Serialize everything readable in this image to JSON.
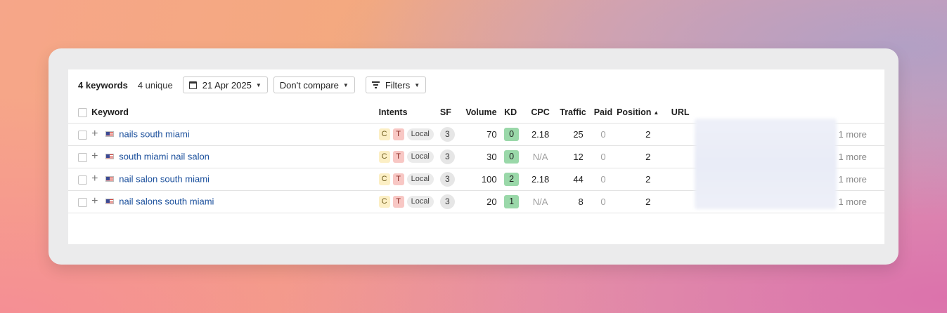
{
  "toolbar": {
    "keyword_count": "4 keywords",
    "unique": "4 unique",
    "date": "21 Apr 2025",
    "compare": "Don't compare",
    "filters": "Filters"
  },
  "columns": {
    "keyword": "Keyword",
    "intents": "Intents",
    "sf": "SF",
    "volume": "Volume",
    "kd": "KD",
    "cpc": "CPC",
    "traffic": "Traffic",
    "paid": "Paid",
    "position": "Position",
    "url": "URL"
  },
  "rows": [
    {
      "keyword": "nails south miami",
      "intent_c": "C",
      "intent_t": "T",
      "local": "Local",
      "sf": "3",
      "volume": "70",
      "kd": "0",
      "kd_color": "#9ad8a9",
      "cpc": "2.18",
      "traffic": "25",
      "paid": "0",
      "position": "2",
      "more": "1 more"
    },
    {
      "keyword": "south miami nail salon",
      "intent_c": "C",
      "intent_t": "T",
      "local": "Local",
      "sf": "3",
      "volume": "30",
      "kd": "0",
      "kd_color": "#9ad8a9",
      "cpc": "N/A",
      "traffic": "12",
      "paid": "0",
      "position": "2",
      "more": "1 more"
    },
    {
      "keyword": "nail salon south miami",
      "intent_c": "C",
      "intent_t": "T",
      "local": "Local",
      "sf": "3",
      "volume": "100",
      "kd": "2",
      "kd_color": "#9ad8a9",
      "cpc": "2.18",
      "traffic": "44",
      "paid": "0",
      "position": "2",
      "more": "1 more"
    },
    {
      "keyword": "nail salons south miami",
      "intent_c": "C",
      "intent_t": "T",
      "local": "Local",
      "sf": "3",
      "volume": "20",
      "kd": "1",
      "kd_color": "#9ad8a9",
      "cpc": "N/A",
      "traffic": "8",
      "paid": "0",
      "position": "2",
      "more": "1 more"
    }
  ],
  "icons": {
    "calendar": "calendar-icon",
    "filter": "filter-icon",
    "flag": "us-flag-icon",
    "add": "plus-icon"
  }
}
